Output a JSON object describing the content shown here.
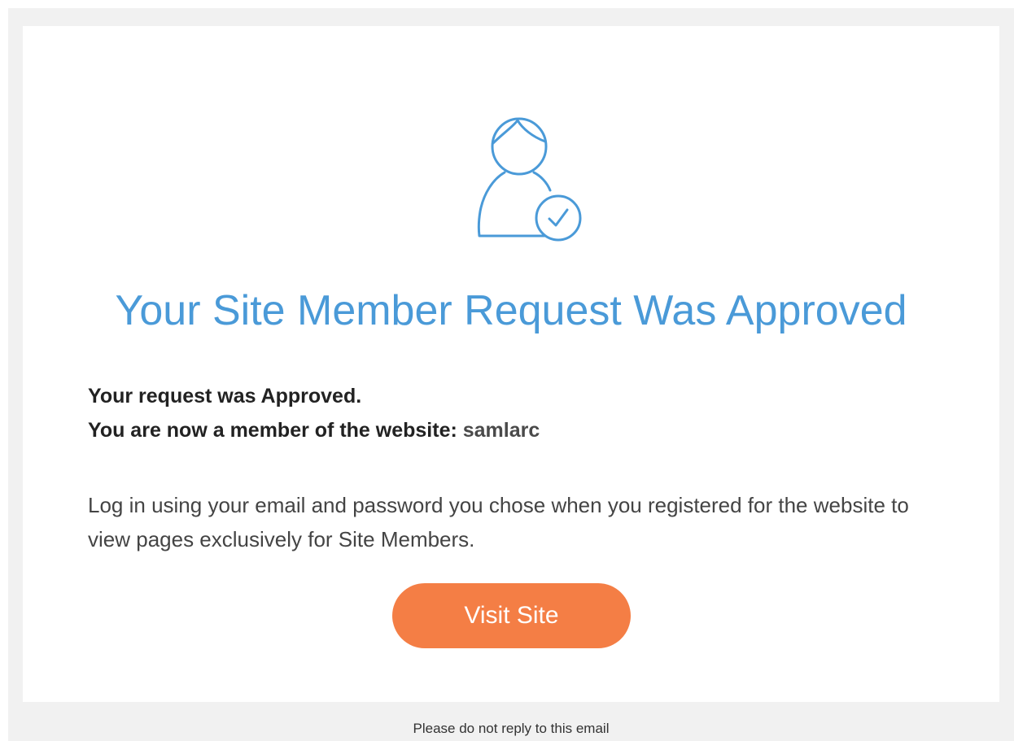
{
  "header": {
    "icon": "member-approved-icon",
    "title": "Your Site Member Request Was Approved"
  },
  "message": {
    "approved_line": "Your request was Approved.",
    "member_line_prefix": "You are now a member of the website:",
    "site_name": "samlarc",
    "instructions": "Log in using your email and password you chose when you registered for the website to view pages exclusively for Site Members."
  },
  "cta": {
    "label": "Visit Site"
  },
  "footer": {
    "note": "Please do not reply to this email"
  },
  "colors": {
    "accent_blue": "#4a9ad8",
    "button_orange": "#f47e45",
    "outer_background": "#f1f1f1"
  }
}
